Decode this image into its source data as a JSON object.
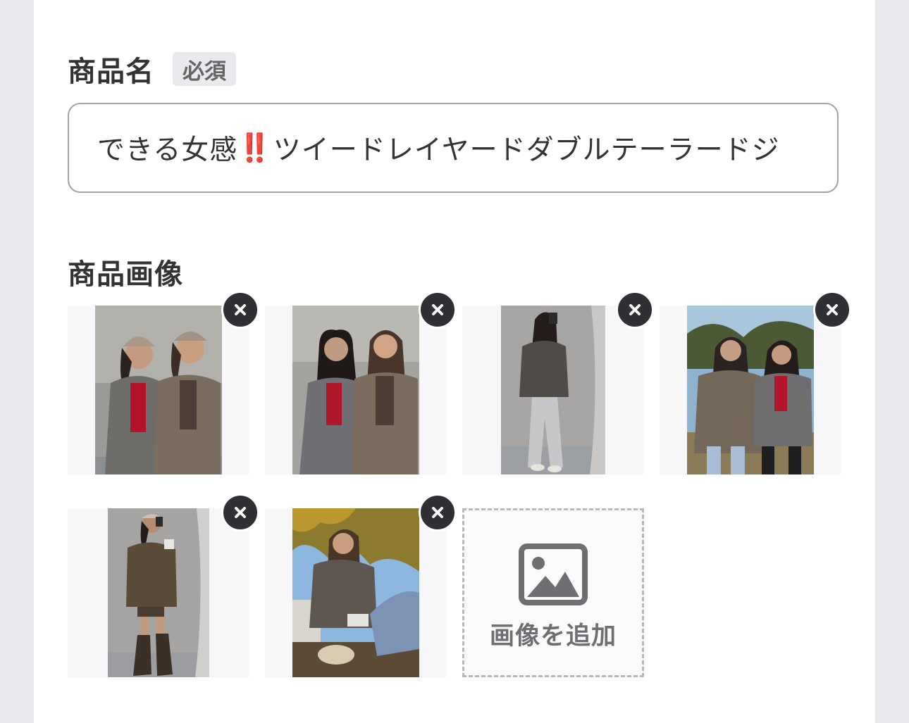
{
  "product_name": {
    "label": "商品名",
    "required_badge": "必須",
    "value_prefix": "できる女感",
    "value_emoji": "‼️",
    "value_suffix": "ツイードレイヤードダブルテーラードジ"
  },
  "product_images": {
    "label": "商品画像",
    "images": [
      {
        "description_icon": "photo-two-women-caps"
      },
      {
        "description_icon": "photo-two-women-glasses"
      },
      {
        "description_icon": "photo-mirror-selfie"
      },
      {
        "description_icon": "photo-two-women-outdoor"
      },
      {
        "description_icon": "photo-mirror-selfie-boots"
      },
      {
        "description_icon": "photo-woman-autumn-tree"
      }
    ],
    "remove_icon": "close-icon",
    "add_image_label": "画像を追加",
    "add_image_icon": "image-icon"
  },
  "colors": {
    "accent_dark": "#2f3033",
    "text": "#333333",
    "badge_bg": "#e9eaee"
  }
}
